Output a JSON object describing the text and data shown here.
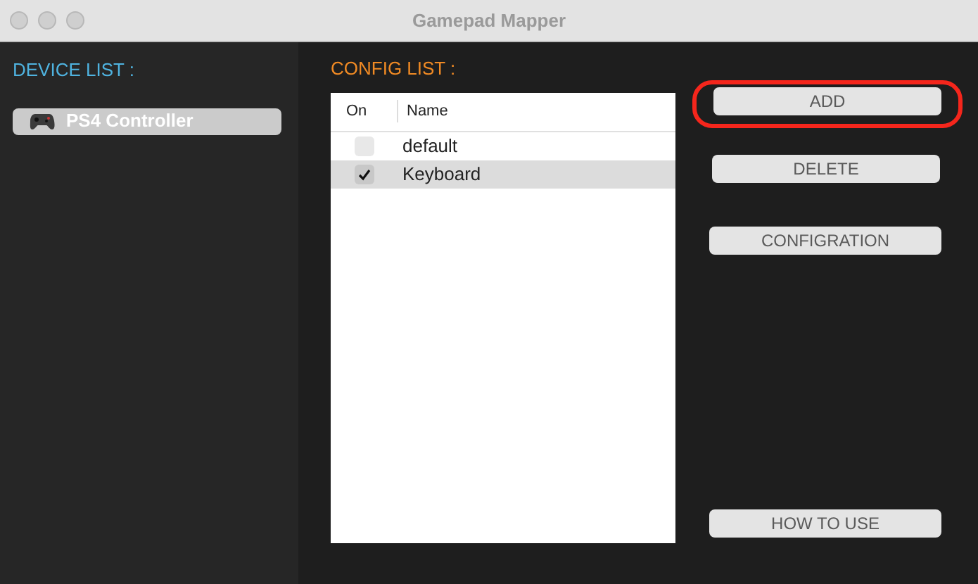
{
  "window": {
    "title": "Gamepad Mapper"
  },
  "device_list": {
    "label": "DEVICE LIST :",
    "items": [
      {
        "name": "PS4 Controller",
        "selected": true
      }
    ]
  },
  "config_list": {
    "label": "CONFIG LIST :",
    "columns": [
      "On",
      "Name"
    ],
    "rows": [
      {
        "on": false,
        "name": "default",
        "selected": false
      },
      {
        "on": true,
        "name": "Keyboard",
        "selected": true
      }
    ]
  },
  "buttons": [
    {
      "label": "ADD",
      "highlighted": true
    },
    {
      "label": "DELETE",
      "highlighted": false
    },
    {
      "label": "CONFIGRATION",
      "highlighted": false
    },
    {
      "label": "HOW TO USE",
      "highlighted": false
    }
  ]
}
